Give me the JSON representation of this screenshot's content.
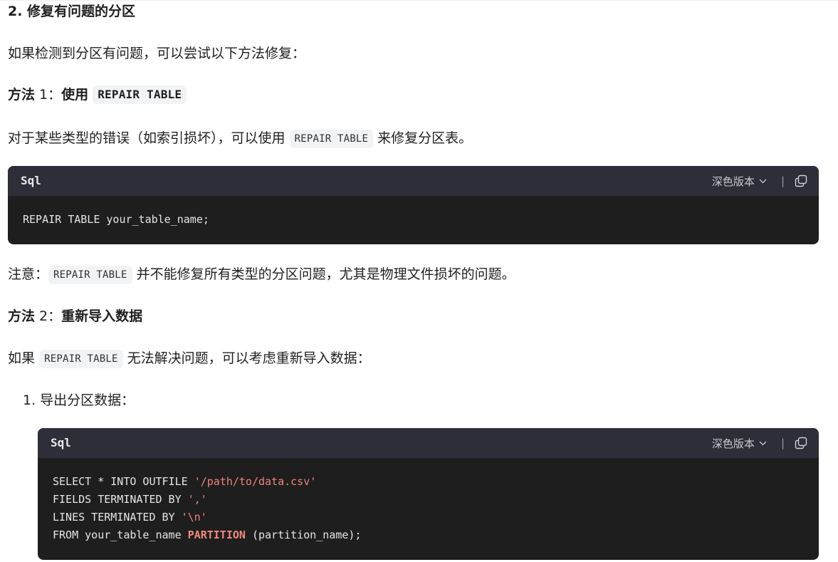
{
  "section_title": "2. 修复有问题的分区",
  "intro": "如果检测到分区有问题，可以尝试以下方法修复：",
  "method1": {
    "prefix": "方法",
    "num": " 1：",
    "word": "使用",
    "code": "REPAIR TABLE"
  },
  "method1_desc": {
    "before": "对于某些类型的错误（如索引损坏），可以使用",
    "code": "REPAIR TABLE",
    "after": "来修复分区表。"
  },
  "block1": {
    "lang": "Sql",
    "theme_label": "深色版本",
    "lines": [
      "REPAIR TABLE your_table_name;"
    ]
  },
  "note": {
    "before": "注意：",
    "code": "REPAIR TABLE",
    "after": "并不能修复所有类型的分区问题，尤其是物理文件损坏的问题。"
  },
  "method2": {
    "prefix": "方法",
    "num": " 2：",
    "word": "重新导入数据"
  },
  "method2_desc": {
    "before": "如果",
    "code": "REPAIR TABLE",
    "after": "无法解决问题，可以考虑重新导入数据："
  },
  "step1": "1. 导出分区数据：",
  "block2": {
    "lang": "Sql",
    "theme_label": "深色版本",
    "l1_plain": "SELECT * INTO OUTFILE ",
    "l1_str": "'/path/to/data.csv'",
    "l2_plain": "FIELDS TERMINATED BY ",
    "l2_str": "','",
    "l3_plain": "LINES TERMINATED BY ",
    "l3_str": "'\\n'",
    "l4_plain": "FROM your_table_name ",
    "l4_kw": "PARTITION",
    "l4_rest": " (partition_name);"
  },
  "icons": {
    "chevron": "chevron-down-icon",
    "copy": "copy-icon"
  },
  "colors": {
    "code_bg": "#1e1e1e",
    "code_header": "#2d2e38",
    "string": "#f08080",
    "inline_bg": "#f2f3f5"
  }
}
